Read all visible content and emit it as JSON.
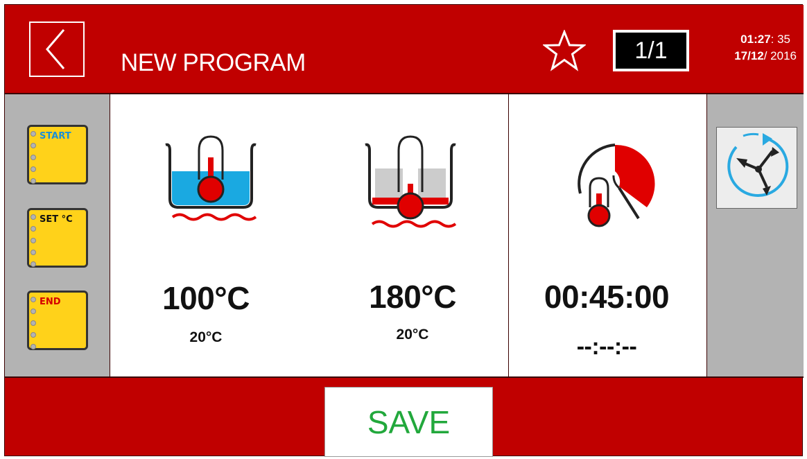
{
  "header": {
    "title": "NEW PROGRAM",
    "page_indicator": "1/1",
    "time_bold": "01:27",
    "time_rest": ": 35",
    "date_bold": "17/12",
    "date_rest": "/ 2016",
    "back_icon": "chevron-left-icon",
    "star_icon": "star-outline-icon"
  },
  "sidebar": {
    "steps": [
      {
        "label": "START",
        "color": "#1a8fd6"
      },
      {
        "label": "SET °C",
        "color": "#111111"
      },
      {
        "label": "END",
        "color": "#d40000"
      }
    ]
  },
  "main": {
    "boil": {
      "icon": "pot-water-heating-icon",
      "target": "100°C",
      "current": "20°C"
    },
    "fry": {
      "icon": "pan-oil-heating-icon",
      "target": "180°C",
      "current": "20°C"
    },
    "timer": {
      "icon": "thermometer-timer-icon",
      "set": "00:45:00",
      "remaining": "--:--:--"
    }
  },
  "right_panel": {
    "icon": "rotation-cycle-icon"
  },
  "footer": {
    "save_label": "SAVE"
  },
  "colors": {
    "brand_red": "#c00000",
    "panel_gray": "#b3b3b3",
    "note_yellow": "#ffd21a",
    "water_blue": "#1aa9e1",
    "save_green": "#22a83c"
  }
}
